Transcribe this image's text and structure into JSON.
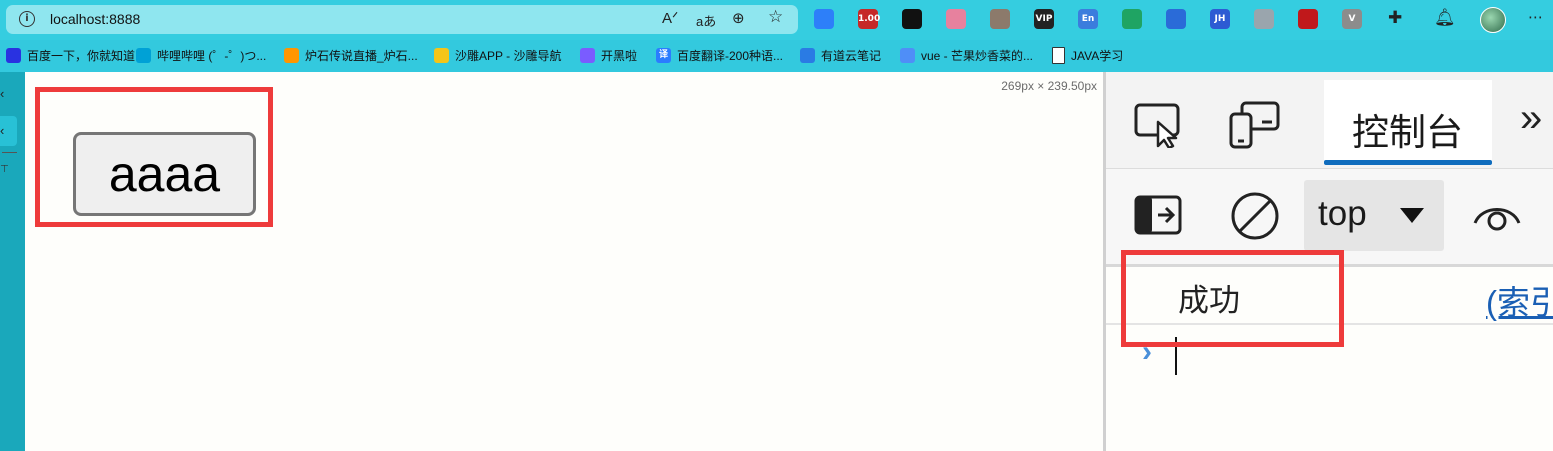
{
  "browser": {
    "url": "localhost:8888",
    "address_icons": [
      "read-aloud-icon",
      "translate-icon",
      "zoom-icon",
      "favorite-add-icon"
    ],
    "address_icon_glyphs": [
      "Aᐟ",
      "aあ",
      "⊕",
      "☆"
    ],
    "extensions": [
      {
        "name": "ext-blue-icon",
        "color": "#2d7ff9",
        "text": ""
      },
      {
        "name": "ext-version-icon",
        "color": "#c62828",
        "text": "1.00"
      },
      {
        "name": "ext-glasses-icon",
        "color": "#111111",
        "text": ""
      },
      {
        "name": "ext-pink-icon",
        "color": "#e7819e",
        "text": ""
      },
      {
        "name": "ext-book-icon",
        "color": "#8c7a6b",
        "text": ""
      },
      {
        "name": "ext-vip-icon",
        "color": "#222222",
        "text": "VIP"
      },
      {
        "name": "ext-en-icon",
        "color": "#3b7ddd",
        "text": "En"
      },
      {
        "name": "ext-shield-icon",
        "color": "#1fa463",
        "text": ""
      },
      {
        "name": "ext-window-icon",
        "color": "#2a6bd8",
        "text": ""
      },
      {
        "name": "ext-jh-icon",
        "color": "#2d5bd3",
        "text": "JH"
      },
      {
        "name": "ext-monitor-icon",
        "color": "#9aa5ad",
        "text": ""
      },
      {
        "name": "ext-red-circle-icon",
        "color": "#c0181b",
        "text": ""
      },
      {
        "name": "ext-v-icon",
        "color": "#8c8c8c",
        "text": "V"
      }
    ]
  },
  "bookmarks": [
    {
      "label": "百度一下，你就知道",
      "icon": "baidu-icon",
      "color": "#2932e1",
      "glyph": ""
    },
    {
      "label": "哔哩哔哩 (゜-゜)つ...",
      "icon": "bilibili-icon",
      "color": "#00a1d6",
      "glyph": ""
    },
    {
      "label": "炉石传说直播_炉石...",
      "icon": "huya-icon",
      "color": "#ff9600",
      "glyph": ""
    },
    {
      "label": "沙雕APP - 沙雕导航",
      "icon": "smile-icon",
      "color": "#f5c518",
      "glyph": ""
    },
    {
      "label": "开黑啦",
      "icon": "kaiheila-icon",
      "color": "#7a5cff",
      "glyph": ""
    },
    {
      "label": "百度翻译-200种语...",
      "icon": "baidu-translate-icon",
      "color": "#2b7cff",
      "glyph": "译"
    },
    {
      "label": "有道云笔记",
      "icon": "youdao-note-icon",
      "color": "#2a7be4",
      "glyph": ""
    },
    {
      "label": "vue - 芒果炒香菜的...",
      "icon": "csdn-icon",
      "color": "#4f8ef7",
      "glyph": ""
    },
    {
      "label": "JAVA学习",
      "icon": "file-icon",
      "color": "#ffffff",
      "glyph": ""
    }
  ],
  "page": {
    "dimensions_label": "269px × 239.50px",
    "button_label": "aaaa"
  },
  "devtools": {
    "tabs": {
      "console_label": "控制台",
      "more_label": "»"
    },
    "toolbar": {
      "context_label": "top"
    },
    "console": {
      "log_message": "成功",
      "log_source": "(索引"
    }
  },
  "colors": {
    "browser_chrome": "#35cde0",
    "highlight_box": "#ee3b3b",
    "tab_underline": "#0f6cbd",
    "link": "#1a5fb4"
  }
}
